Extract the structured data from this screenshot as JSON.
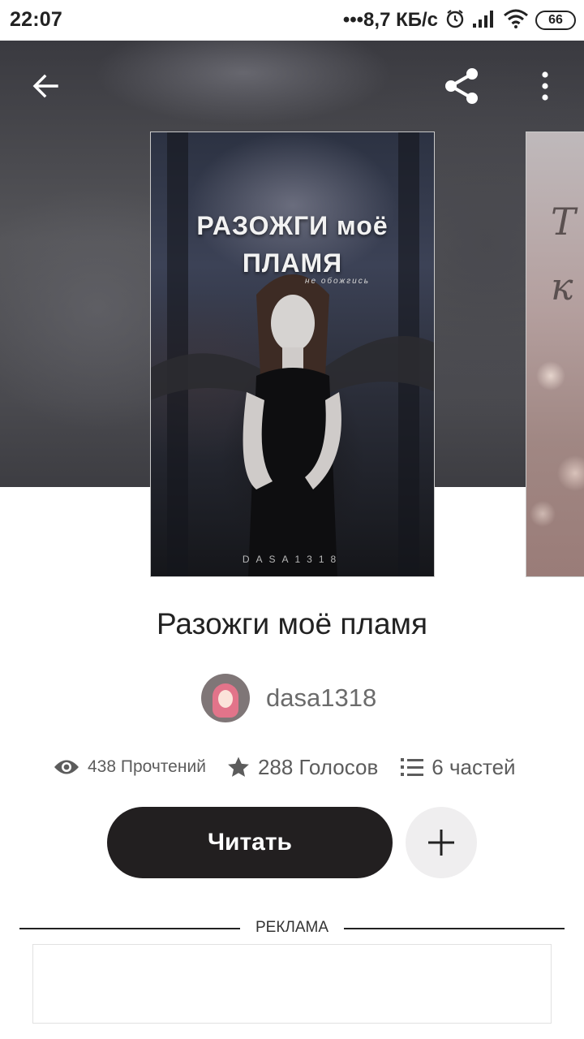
{
  "status_bar": {
    "time": "22:07",
    "net_speed": "•••8,7 КБ/с",
    "battery": "66",
    "icons": [
      "alarm-icon",
      "signal-icon",
      "wifi-icon",
      "battery-icon"
    ]
  },
  "header": {
    "back_icon": "arrow-left-icon",
    "share_icon": "share-icon",
    "menu_icon": "more-vertical-icon"
  },
  "cover": {
    "title_line1": "РАЗОЖГИ моё",
    "title_line2": "ПЛАМЯ",
    "subtitle": "не обожгись",
    "author": "DASA1318"
  },
  "next_cover": {
    "text_line1": "Т",
    "text_line2": "к"
  },
  "book": {
    "title": "Разожги моё пламя",
    "author": "dasa1318"
  },
  "stats": {
    "views": "438 Прочтений",
    "votes": "288 Голосов",
    "parts": "6 частей"
  },
  "actions": {
    "read_label": "Читать",
    "add_icon": "plus-icon"
  },
  "ad": {
    "label": "РЕКЛАМА"
  },
  "colors": {
    "button_dark": "#221f20",
    "add_button_bg": "#efeeef",
    "stat_text": "#5c5c5c"
  }
}
